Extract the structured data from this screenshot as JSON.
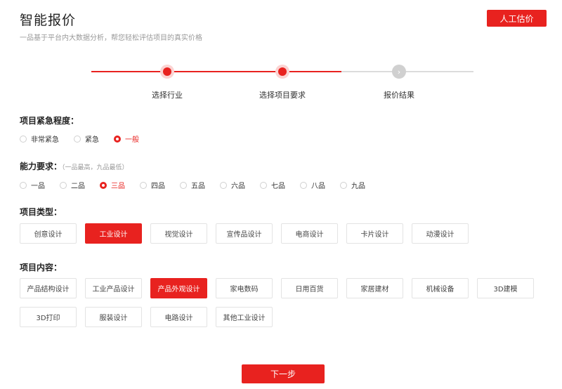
{
  "header": {
    "title": "智能报价",
    "subtitle": "一品基于平台内大数据分析，帮您轻松评估项目的真实价格",
    "manual_button": "人工估价"
  },
  "steps": [
    {
      "label": "选择行业",
      "state": "done"
    },
    {
      "label": "选择项目要求",
      "state": "current"
    },
    {
      "label": "报价结果",
      "state": "pending"
    }
  ],
  "urgency": {
    "title": "项目紧急程度：",
    "options": [
      "非常紧急",
      "紧急",
      "一般"
    ],
    "selected": "一般"
  },
  "ability": {
    "title": "能力要求：",
    "note": "（一品最高，九品最低）",
    "options": [
      "一品",
      "二品",
      "三品",
      "四品",
      "五品",
      "六品",
      "七品",
      "八品",
      "九品"
    ],
    "selected": "三品"
  },
  "project_type": {
    "title": "项目类型：",
    "options": [
      "创意设计",
      "工业设计",
      "视觉设计",
      "宣传品设计",
      "电商设计",
      "卡片设计",
      "动漫设计"
    ],
    "selected": "工业设计"
  },
  "project_content": {
    "title": "项目内容：",
    "options_row1": [
      "产品结构设计",
      "工业产品设计",
      "产品外观设计",
      "家电数码",
      "日用百货",
      "家居建材",
      "机械设备",
      "3D建模"
    ],
    "options_row2": [
      "3D打印",
      "服装设计",
      "电路设计",
      "其他工业设计"
    ],
    "selected": "产品外观设计"
  },
  "next_button": "下一步",
  "colors": {
    "accent": "#e8221f",
    "border": "#e3e3e3",
    "muted": "#999999"
  }
}
